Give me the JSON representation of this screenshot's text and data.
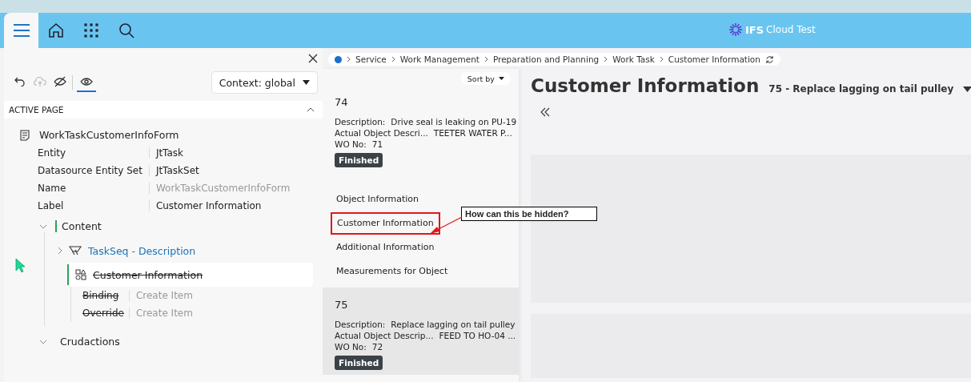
{
  "header": {
    "brand": "IFS",
    "product": "Cloud Test"
  },
  "designer": {
    "toolbar": [
      {
        "kind": "undo",
        "disabled": false,
        "selected": false
      },
      {
        "kind": "upload",
        "disabled": true,
        "selected": false
      },
      {
        "kind": "hide",
        "disabled": false,
        "selected": false
      },
      {
        "kind": "view",
        "disabled": false,
        "selected": true
      }
    ],
    "context": "Context: global",
    "section": {
      "title": "ACTIVE PAGE",
      "expanded": true
    },
    "page": {
      "name": "WorkTaskCustomerInfoForm",
      "properties": [
        {
          "label": "Entity",
          "value": "JtTask",
          "muted": false
        },
        {
          "label": "Datasource Entity Set",
          "value": "JtTaskSet",
          "muted": false
        },
        {
          "label": "Name",
          "value": "WorkTaskCustomerInfoForm",
          "muted": true
        },
        {
          "label": "Label",
          "value": "Customer Information",
          "muted": false
        }
      ]
    },
    "tree": [
      {
        "label": "Content",
        "expanded": true,
        "children": [
          {
            "label": "TaskSeq - Description",
            "kind": "field",
            "expanded": false,
            "removed": false,
            "selected": false,
            "link": true
          },
          {
            "label": "Customer Information",
            "kind": "group",
            "expanded": true,
            "removed": true,
            "selected": true,
            "link": false,
            "properties": [
              {
                "label": "Binding",
                "value": "Create Item"
              },
              {
                "label": "Override",
                "value": "Create Item"
              }
            ]
          }
        ]
      },
      {
        "label": "Crudactions",
        "expanded": true
      }
    ]
  },
  "breadcrumb": [
    "Service",
    "Work Management",
    "Preparation and Planning",
    "Work Task",
    "Customer Information"
  ],
  "list": {
    "sort": "Sort by",
    "records": [
      {
        "id": "74",
        "selected": false,
        "fields": [
          {
            "label": "Description:",
            "value": "Drive seal is leaking on PU-19"
          },
          {
            "label": "Actual Object Descri...",
            "value": "TEETER WATER P..."
          },
          {
            "label": "WO No:",
            "value": "71"
          }
        ],
        "status": "Finished",
        "links": [
          {
            "label": "Object Information",
            "highlighted": false
          },
          {
            "label": "Customer Information",
            "highlighted": true
          },
          {
            "label": "Additional Information",
            "highlighted": false
          },
          {
            "label": "Measurements for Object",
            "highlighted": false
          }
        ]
      },
      {
        "id": "75",
        "selected": true,
        "fields": [
          {
            "label": "Description:",
            "value": "Replace lagging on tail pulley"
          },
          {
            "label": "Actual Object Descrip...",
            "value": "FEED TO HO-04 ..."
          },
          {
            "label": "WO No:",
            "value": "72"
          }
        ],
        "status": "Finished"
      }
    ]
  },
  "content": {
    "title": "Customer Information",
    "record": "75 - Replace lagging on tail pulley"
  },
  "annotation": {
    "text": "How can this be hidden?"
  }
}
